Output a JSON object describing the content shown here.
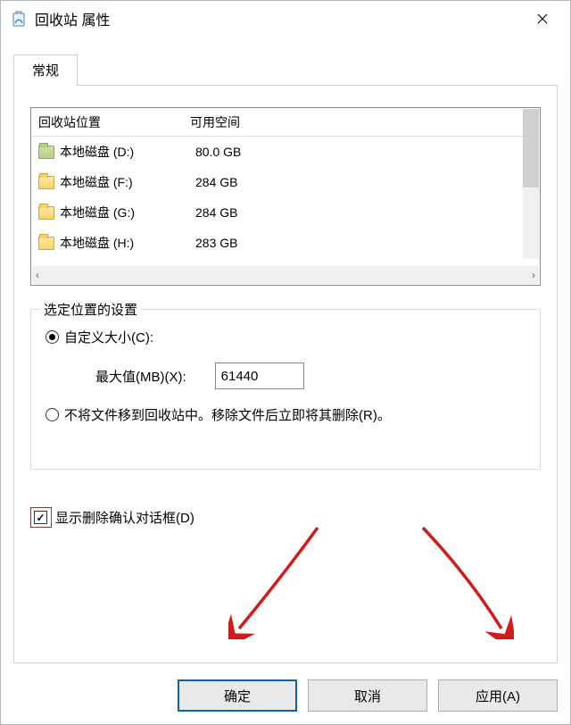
{
  "window": {
    "title": "回收站 属性"
  },
  "tab": {
    "label": "常规"
  },
  "table": {
    "head": {
      "location": "回收站位置",
      "available": "可用空间"
    },
    "rows": [
      {
        "name": "本地磁盘 (D:)",
        "space": "80.0 GB",
        "iconClass": "folder-green"
      },
      {
        "name": "本地磁盘 (F:)",
        "space": "284 GB",
        "iconClass": "folder-yellow"
      },
      {
        "name": "本地磁盘 (G:)",
        "space": "284 GB",
        "iconClass": "folder-yellow"
      },
      {
        "name": "本地磁盘 (H:)",
        "space": "283 GB",
        "iconClass": "folder-yellow"
      }
    ]
  },
  "settings": {
    "legend": "选定位置的设置",
    "customSizeLabel": "自定义大小(C):",
    "maxLabel": "最大值(MB)(X):",
    "maxValue": "61440",
    "noRecycleLabel": "不将文件移到回收站中。移除文件后立即将其删除(R)。"
  },
  "confirmCheckbox": {
    "label": "显示删除确认对话框(D)"
  },
  "buttons": {
    "ok": "确定",
    "cancel": "取消",
    "apply": "应用(A)"
  }
}
